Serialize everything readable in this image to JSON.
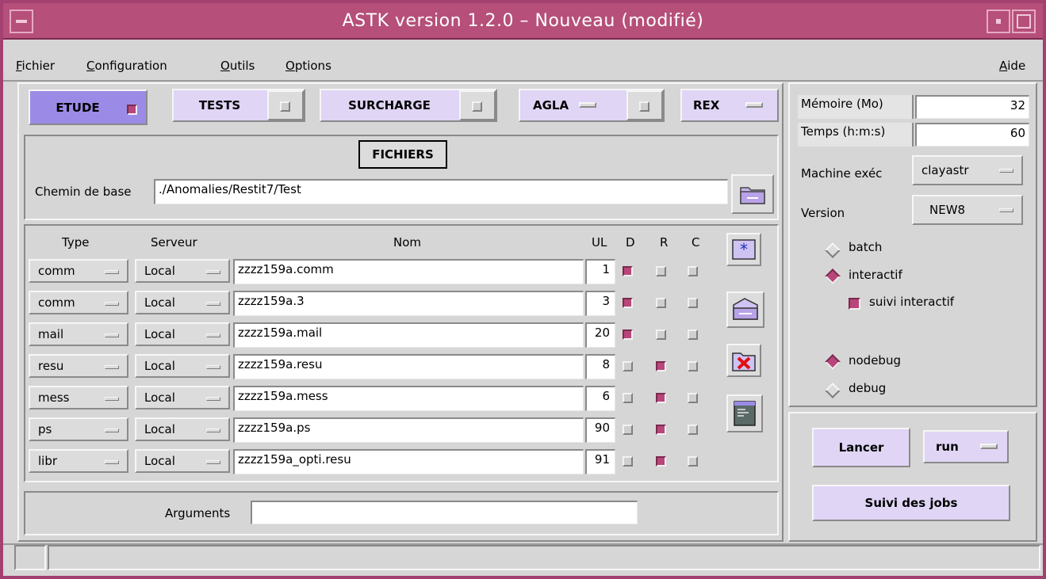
{
  "window": {
    "title": "ASTK version 1.2.0 – Nouveau (modifié)"
  },
  "menu": {
    "fichier": {
      "u": "F",
      "rest": "ichier"
    },
    "configuration": {
      "u": "C",
      "rest": "onfiguration"
    },
    "outils": {
      "u": "O",
      "rest": "utils"
    },
    "options": {
      "u": "O",
      "rest": "ptions"
    },
    "aide": {
      "u": "A",
      "rest": "ide"
    }
  },
  "tabs": {
    "etude": {
      "label": "ETUDE",
      "checked": true
    },
    "tests": {
      "label": "TESTS",
      "checked": false
    },
    "surcharge": {
      "label": "SURCHARGE",
      "checked": false
    },
    "agla": {
      "label": "AGLA",
      "checked": false
    },
    "rex": {
      "label": "REX"
    }
  },
  "fichiers": {
    "heading": "FICHIERS",
    "chemin_label": "Chemin de base",
    "chemin_value": "./Anomalies/Restit7/Test"
  },
  "table": {
    "headers": {
      "type": "Type",
      "serveur": "Serveur",
      "nom": "Nom",
      "ul": "UL",
      "d": "D",
      "r": "R",
      "c": "C"
    },
    "rows": [
      {
        "type": "comm",
        "serveur": "Local",
        "nom": "zzzz159a.comm",
        "ul": "1",
        "d": true,
        "r": false,
        "c": false
      },
      {
        "type": "comm",
        "serveur": "Local",
        "nom": "zzzz159a.3",
        "ul": "3",
        "d": true,
        "r": false,
        "c": false
      },
      {
        "type": "mail",
        "serveur": "Local",
        "nom": "zzzz159a.mail",
        "ul": "20",
        "d": true,
        "r": false,
        "c": false
      },
      {
        "type": "resu",
        "serveur": "Local",
        "nom": "zzzz159a.resu",
        "ul": "8",
        "d": false,
        "r": true,
        "c": false
      },
      {
        "type": "mess",
        "serveur": "Local",
        "nom": "zzzz159a.mess",
        "ul": "6",
        "d": false,
        "r": true,
        "c": false
      },
      {
        "type": "ps",
        "serveur": "Local",
        "nom": "zzzz159a.ps",
        "ul": "90",
        "d": false,
        "r": true,
        "c": false
      },
      {
        "type": "libr",
        "serveur": "Local",
        "nom": "zzzz159a_opti.resu",
        "ul": "91",
        "d": false,
        "r": true,
        "c": false
      }
    ]
  },
  "arguments": {
    "label": "Arguments",
    "value": ""
  },
  "params": {
    "memoire_label": "Mémoire (Mo)",
    "memoire_value": "32",
    "temps_label": "Temps (h:m:s)",
    "temps_value": "60",
    "machine_label": "Machine exéc",
    "machine_value": "clayastr",
    "version_label": "Version",
    "version_value": "NEW8"
  },
  "mode": {
    "batch": "batch",
    "interactif": "interactif",
    "selected": "interactif",
    "suivi_interactif": "suivi interactif",
    "suivi_checked": true
  },
  "debug": {
    "nodebug": "nodebug",
    "debug": "debug",
    "selected": "nodebug"
  },
  "actions": {
    "lancer": "Lancer",
    "run": "run",
    "suivi_jobs": "Suivi des jobs"
  },
  "colors": {
    "accent": "#b64f79",
    "tab_active": "#9c8be6",
    "tab": "#e0d5f5",
    "check_on": "#b8467a"
  }
}
